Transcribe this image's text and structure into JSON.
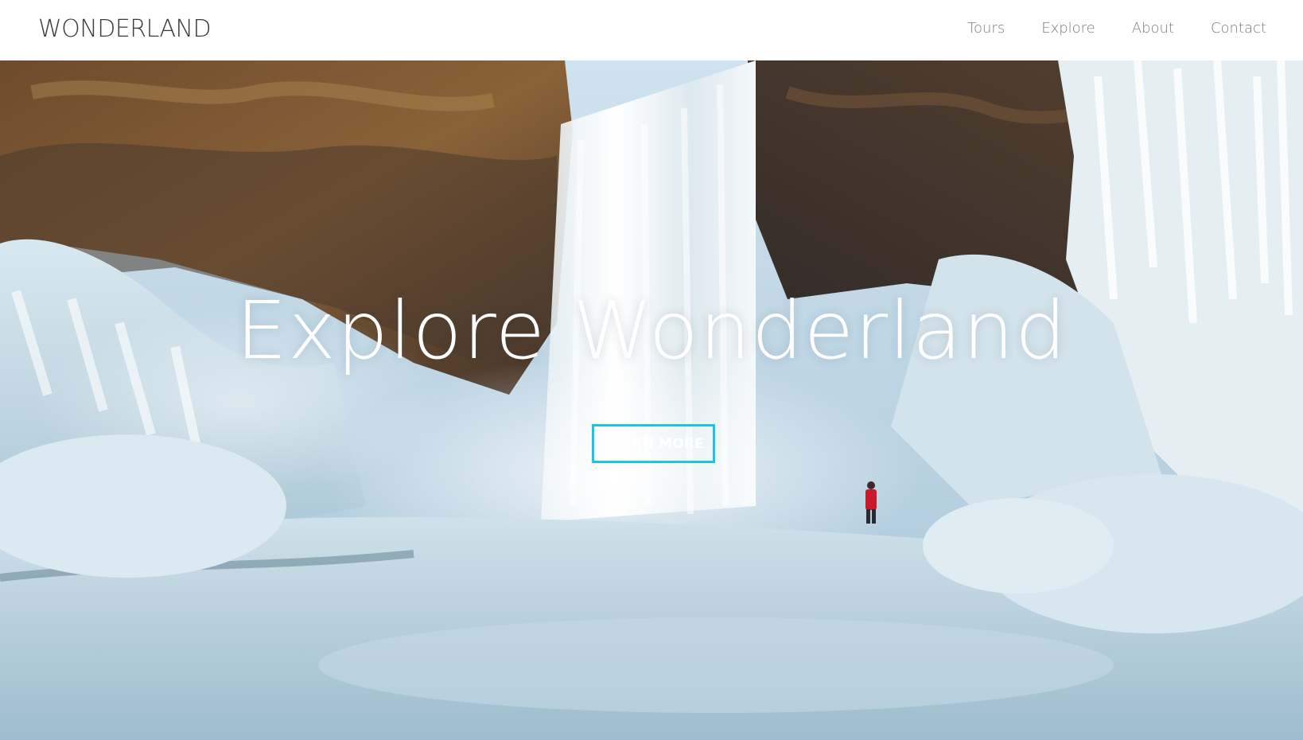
{
  "header": {
    "brand": "WONDERLAND",
    "nav": [
      {
        "label": "Tours"
      },
      {
        "label": "Explore"
      },
      {
        "label": "About"
      },
      {
        "label": "Contact"
      }
    ]
  },
  "hero": {
    "title": "Explore Wonderland",
    "cta_label": "LEARN MORE",
    "image_description_icon": "frozen-waterfall-photo"
  },
  "colors": {
    "accent": "#1cc4ec",
    "header_bg": "#ffffff",
    "brand_text": "#3b3b3b",
    "nav_text": "#7c7c7c"
  }
}
